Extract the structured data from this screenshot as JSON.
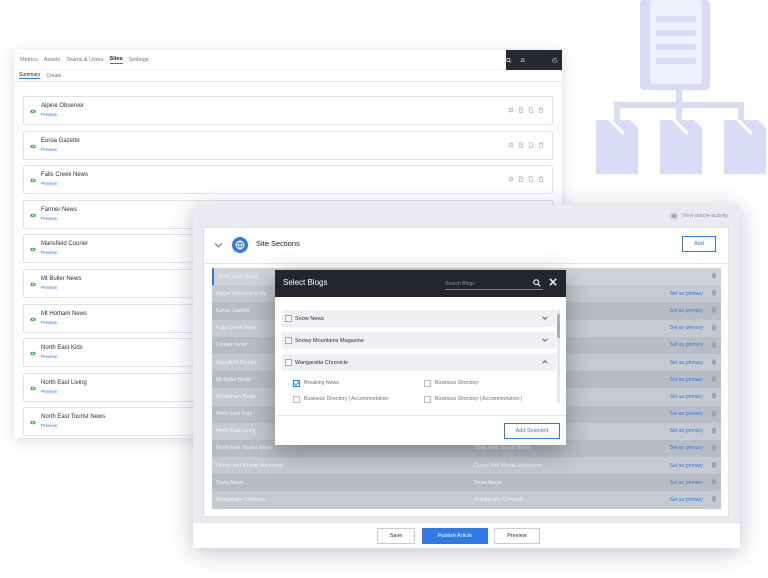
{
  "sites_window": {
    "nav": [
      "Metrics",
      "Assets",
      "Teams & Users",
      "Sites",
      "Settings"
    ],
    "active_nav": "Sites",
    "subnav": [
      "Summary",
      "Create"
    ],
    "preview_label": "Preview",
    "sites": [
      {
        "name": "Alpine Observer"
      },
      {
        "name": "Euroa Gazette"
      },
      {
        "name": "Falls Creek News"
      },
      {
        "name": "Farmer News"
      },
      {
        "name": "Mansfield Courier"
      },
      {
        "name": "Mt Buller News"
      },
      {
        "name": "Mt Hotham News"
      },
      {
        "name": "North East Kids"
      },
      {
        "name": "North East Living"
      },
      {
        "name": "North East Tourist News"
      }
    ]
  },
  "sections_window": {
    "view_activity": "View article activity",
    "title": "Site Sections",
    "add_label": "Add",
    "set_primary_label": "Set as primary",
    "rows": [
      {
        "col1": "North East Media",
        "col2": ""
      },
      {
        "col1": "Alpine Observer & My",
        "col2": ""
      },
      {
        "col1": "Euroa Gazette",
        "col2": ""
      },
      {
        "col1": "Falls Creek News",
        "col2": ""
      },
      {
        "col1": "Farmer News",
        "col2": ""
      },
      {
        "col1": "Mansfield Courier",
        "col2": ""
      },
      {
        "col1": "Mt Buller News",
        "col2": ""
      },
      {
        "col1": "Mt Hotham News",
        "col2": ""
      },
      {
        "col1": "North East Kids",
        "col2": ""
      },
      {
        "col1": "North East Living",
        "col2": ""
      },
      {
        "col1": "North East Tourist News",
        "col2": "North East Tourist News"
      },
      {
        "col1": "Ovens and Murray Advertiser",
        "col2": "Ovens And Murray Advertiser"
      },
      {
        "col1": "Snow News",
        "col2": "Snow News"
      },
      {
        "col1": "Wangaratta Chronicle",
        "col2": "Wangaratta Chronicle"
      }
    ],
    "footer": {
      "save": "Save",
      "publish": "Publish Article",
      "preview": "Preview"
    }
  },
  "modal": {
    "title": "Select Blogs",
    "search_placeholder": "Search Blogs",
    "blogs": [
      {
        "name": "Snow News",
        "expanded": false
      },
      {
        "name": "Snowy Mountains Magazine",
        "expanded": false
      },
      {
        "name": "Wangaratta Chronicle",
        "expanded": true
      }
    ],
    "options": [
      {
        "label": "Breaking News",
        "checked": true
      },
      {
        "label": "Business Directory",
        "checked": false
      },
      {
        "label": "Business Directory | Accommodation",
        "checked": false
      },
      {
        "label": "Business Directory | Accommodation |",
        "checked": false
      }
    ],
    "add_selected": "Add Selected"
  },
  "colors": {
    "accent": "#2f7ae5",
    "dark_header": "#23262e",
    "illustration": "#d9dcf5"
  }
}
